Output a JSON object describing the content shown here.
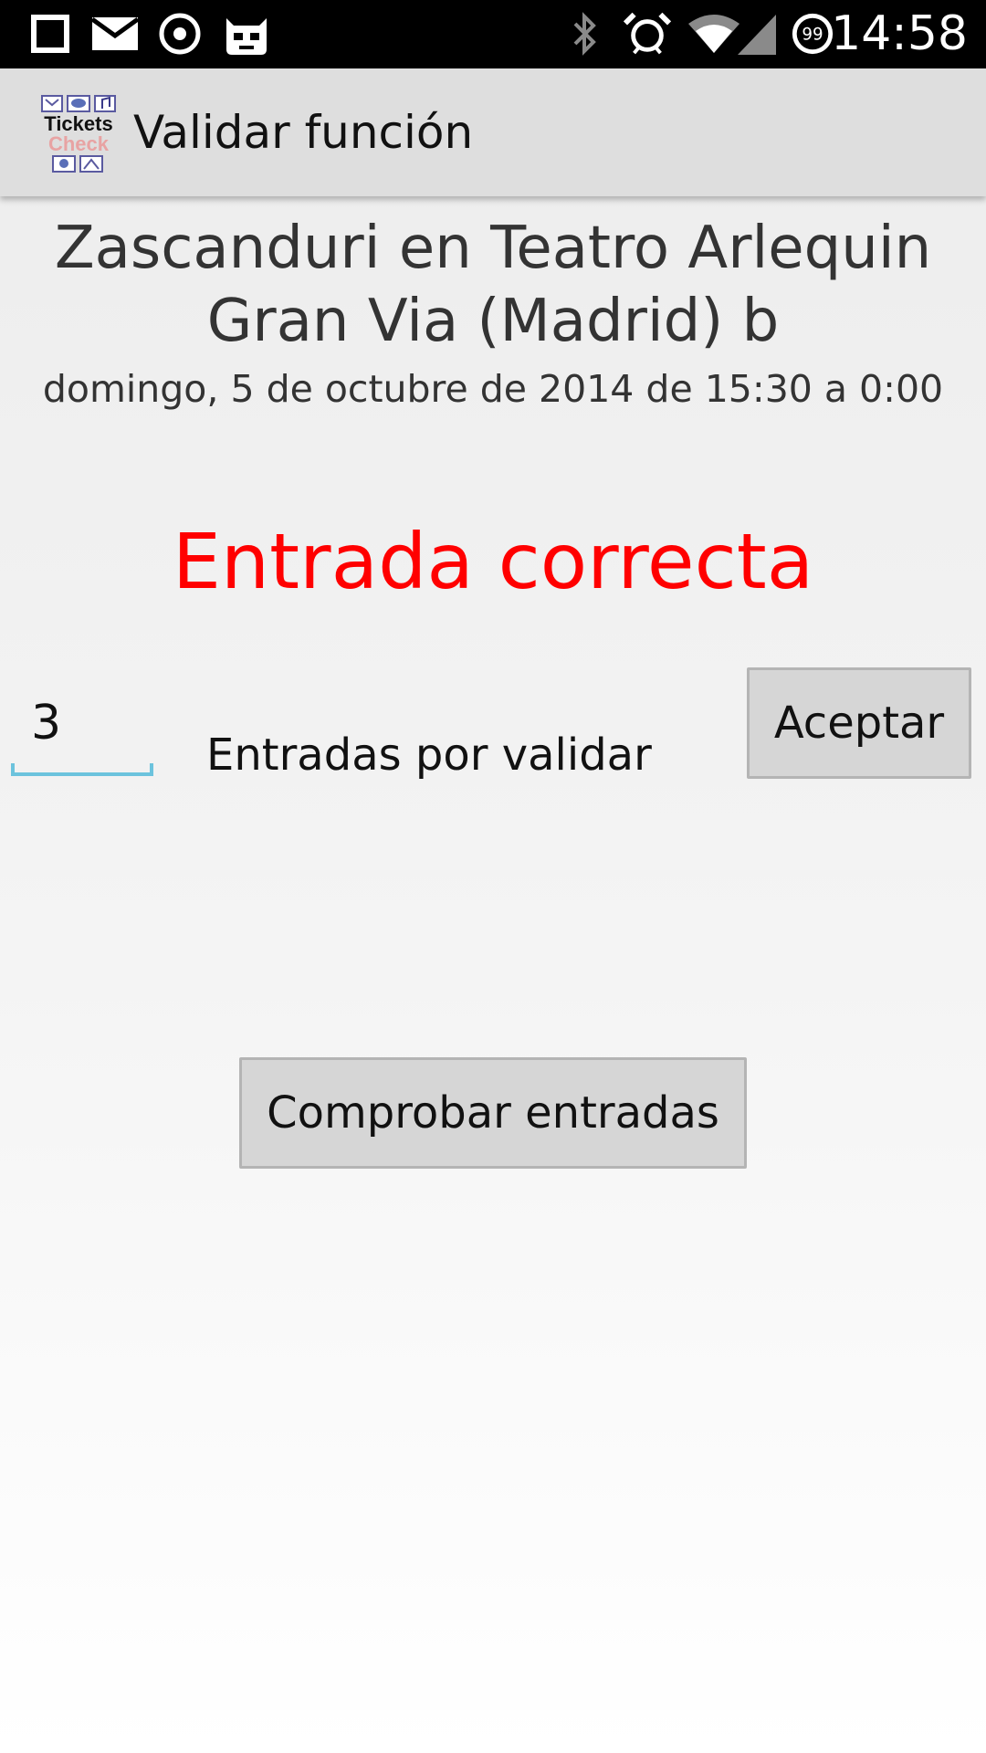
{
  "status_bar": {
    "time": "14:58",
    "icons": [
      "square-icon",
      "mail-icon",
      "circle-dot-icon",
      "cyanogen-mascot-icon",
      "bluetooth-icon",
      "alarm-icon",
      "wifi-icon",
      "signal-icon",
      "battery-99-icon"
    ],
    "battery_label": "99"
  },
  "action_bar": {
    "logo_text_top": "Tickets",
    "logo_text_bottom": "Check",
    "title": "Validar función"
  },
  "event": {
    "name": "Zascanduri en Teatro Arlequin Gran Via (Madrid) b",
    "date": "domingo, 5 de octubre de 2014 de 15:30 a 0:00"
  },
  "result": {
    "text": "Entrada correcta",
    "color": "#ff0000"
  },
  "validation": {
    "quantity_value": "3",
    "quantity_label": "Entradas por validar",
    "accept_label": "Aceptar"
  },
  "check_button_label": "Comprobar entradas",
  "colors": {
    "status_bar_bg": "#000000",
    "action_bar_bg": "#dedede",
    "input_underline": "#6cc3dd",
    "button_bg": "#d6d6d6"
  }
}
